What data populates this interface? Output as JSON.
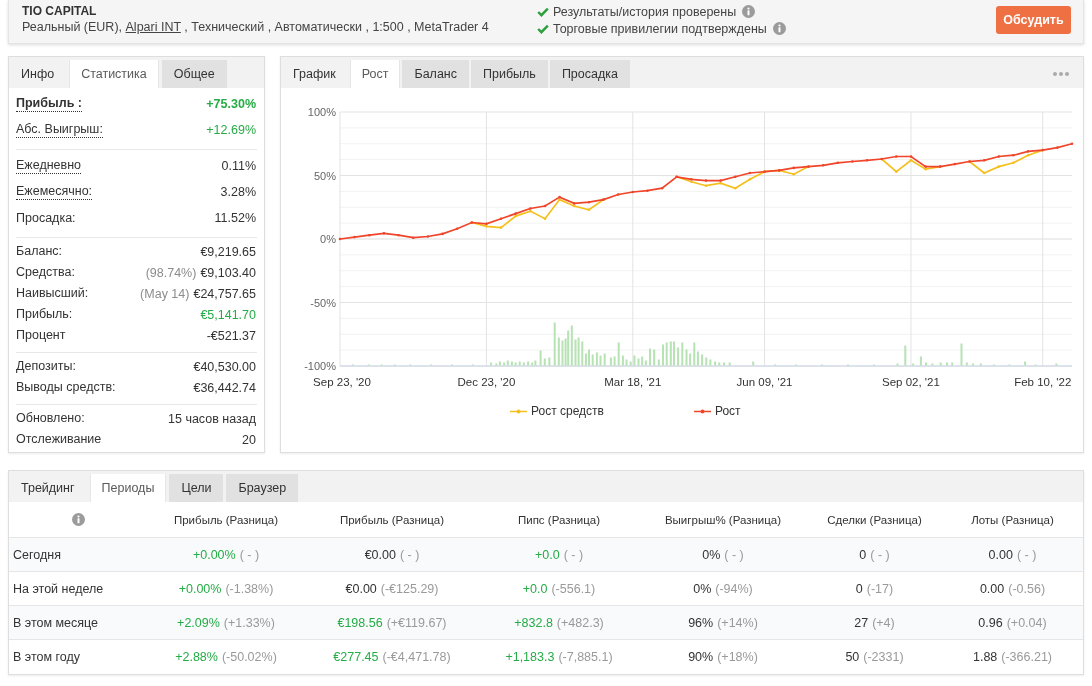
{
  "header": {
    "title": "TIO CAPITAL",
    "account": {
      "type": "Реальный (EUR),",
      "broker": "Alpari INT",
      "rest": ", Технический , Автоматически , 1:500 , MetaTrader 4"
    },
    "verifications": [
      {
        "text": "Результаты/история проверены",
        "verified": true
      },
      {
        "text": "Торговые привилегии подтверждены",
        "verified": true
      }
    ],
    "button": "Обсудить"
  },
  "stats_panel": {
    "tabs": [
      {
        "label": "Инфо",
        "selected": false
      },
      {
        "label": "Статистика",
        "selected": true
      },
      {
        "label": "Общее",
        "selected": false
      }
    ],
    "groups": [
      {
        "rows": [
          {
            "label": "Прибыль :",
            "value": "+75.30%",
            "hint": true,
            "emphasis": true,
            "positive": true
          },
          {
            "label": "Абс. Выигрыш:",
            "value": "+12.69%",
            "hint": true,
            "emphasis": false,
            "positive": true
          }
        ]
      },
      {
        "rows": [
          {
            "label": "Ежедневно",
            "value": "0.11%",
            "hint": true,
            "emphasis": false,
            "positive": false
          },
          {
            "label": "Ежемесячно:",
            "value": "3.28%",
            "hint": true,
            "emphasis": false,
            "positive": false
          },
          {
            "label": "Просадка:",
            "value": "11.52%",
            "hint": false,
            "emphasis": false,
            "positive": false
          }
        ]
      },
      {
        "rows": [
          {
            "label": "Баланс:",
            "value": "€9,219.65",
            "hint": false,
            "emphasis": false,
            "positive": false
          },
          {
            "label": "Средства:",
            "note": "(98.74%)",
            "value": "€9,103.40",
            "hint": false,
            "emphasis": false,
            "positive": false
          },
          {
            "label": "Наивысший:",
            "note": "(May 14)",
            "value": "€24,757.65",
            "hint": false,
            "emphasis": false,
            "positive": false
          },
          {
            "label": "Прибыль:",
            "value": "€5,141.70",
            "hint": false,
            "emphasis": false,
            "positive": true
          },
          {
            "label": "Процент",
            "value": "-€521.37",
            "hint": false,
            "emphasis": false,
            "positive": false
          }
        ]
      },
      {
        "rows": [
          {
            "label": "Депозиты:",
            "value": "€40,530.00",
            "hint": false,
            "emphasis": false,
            "positive": false
          },
          {
            "label": "Выводы средств:",
            "value": "€36,442.74",
            "hint": false,
            "emphasis": false,
            "positive": false
          }
        ]
      },
      {
        "rows": [
          {
            "label": "Обновлено:",
            "value": "15 часов назад",
            "hint": false,
            "emphasis": false,
            "positive": false
          },
          {
            "label": "Отслеживание",
            "value": "20",
            "hint": false,
            "emphasis": false,
            "positive": false
          }
        ]
      }
    ]
  },
  "chart_panel": {
    "tabs": [
      {
        "label": "График",
        "selected": false
      },
      {
        "label": "Рост",
        "selected": true
      },
      {
        "label": "Баланс",
        "selected": false
      },
      {
        "label": "Прибыль",
        "selected": false
      },
      {
        "label": "Просадка",
        "selected": false
      }
    ],
    "chart_data": {
      "type": "line",
      "categories": [
        "Sep 23, '20",
        null,
        null,
        null,
        null,
        null,
        null,
        null,
        null,
        null,
        "Dec 23, '20",
        null,
        null,
        null,
        null,
        null,
        null,
        null,
        null,
        null,
        "Mar 18, '21",
        null,
        null,
        null,
        null,
        null,
        null,
        null,
        null,
        "Jun 09, '21",
        null,
        null,
        null,
        null,
        null,
        null,
        null,
        null,
        null,
        "Sep 02, '21",
        null,
        null,
        null,
        null,
        null,
        null,
        null,
        null,
        "Feb 10, '22",
        null,
        null
      ],
      "series": [
        {
          "name": "Рост средств",
          "color": "#f5c01e",
          "values": [
            null,
            null,
            null,
            null,
            null,
            null,
            null,
            null,
            null,
            13,
            10,
            9,
            18,
            22,
            16,
            31,
            26,
            23,
            31,
            null,
            null,
            null,
            null,
            49,
            45,
            42,
            44,
            40,
            47,
            53,
            54,
            51,
            57,
            null,
            null,
            null,
            null,
            63,
            53,
            62,
            55,
            57,
            null,
            61,
            52,
            57,
            60,
            66,
            70,
            null,
            null
          ]
        },
        {
          "name": "Рост",
          "color": "#f0452b",
          "values": [
            0,
            1.5,
            3,
            4.5,
            3,
            1,
            2,
            4,
            8,
            13,
            12,
            16,
            20,
            24,
            26,
            33,
            28,
            29,
            31,
            35,
            37,
            38,
            40,
            49,
            47,
            46,
            46,
            49,
            52,
            53,
            54,
            56,
            57,
            58,
            60,
            61,
            62,
            63,
            65,
            65,
            57,
            57,
            59,
            61,
            62,
            65,
            66,
            69,
            70,
            72,
            75
          ]
        }
      ],
      "ylim": [
        -100,
        100
      ],
      "yticks": [
        {
          "value": 100,
          "label": "100%"
        },
        {
          "value": 50,
          "label": "50%"
        },
        {
          "value": 0,
          "label": "0%"
        },
        {
          "value": -50,
          "label": "-50%"
        },
        {
          "value": -100,
          "label": "-100%"
        }
      ],
      "grid": true,
      "legend": "bottom"
    }
  },
  "periods_panel": {
    "tabs": [
      {
        "label": "Трейдинг",
        "selected": false
      },
      {
        "label": "Периоды",
        "selected": true
      },
      {
        "label": "Цели",
        "selected": false
      },
      {
        "label": "Браузер",
        "selected": false
      }
    ],
    "columns": [
      "Прибыль (Разница)",
      "Прибыль (Разница)",
      "Пипс (Разница)",
      "Выигрыш% (Разница)",
      "Сделки (Разница)",
      "Лоты (Разница)"
    ],
    "rows": [
      {
        "label": "Сегодня",
        "cells": [
          {
            "value": "+0.00%",
            "change": "( - )",
            "positive": true
          },
          {
            "value": "€0.00",
            "change": "( - )",
            "positive": false
          },
          {
            "value": "+0.0",
            "change": "( - )",
            "positive": true
          },
          {
            "value": "0%",
            "change": "( - )",
            "positive": false
          },
          {
            "value": "0",
            "change": "( - )",
            "positive": false
          },
          {
            "value": "0.00",
            "change": "( - )",
            "positive": false
          }
        ]
      },
      {
        "label": "На этой неделе",
        "cells": [
          {
            "value": "+0.00%",
            "change": "(-1.38%)",
            "positive": true
          },
          {
            "value": "€0.00",
            "change": "(-€125.29)",
            "positive": false
          },
          {
            "value": "+0.0",
            "change": "(-556.1)",
            "positive": true
          },
          {
            "value": "0%",
            "change": "(-94%)",
            "positive": false
          },
          {
            "value": "0",
            "change": "(-17)",
            "positive": false
          },
          {
            "value": "0.00",
            "change": "(-0.56)",
            "positive": false
          }
        ]
      },
      {
        "label": "В этом месяце",
        "cells": [
          {
            "value": "+2.09%",
            "change": "(+1.33%)",
            "positive": true
          },
          {
            "value": "€198.56",
            "change": "(+€119.67)",
            "positive": true
          },
          {
            "value": "+832.8",
            "change": "(+482.3)",
            "positive": true
          },
          {
            "value": "96%",
            "change": "(+14%)",
            "positive": false
          },
          {
            "value": "27",
            "change": "(+4)",
            "positive": false
          },
          {
            "value": "0.96",
            "change": "(+0.04)",
            "positive": false
          }
        ]
      },
      {
        "label": "В этом году",
        "cells": [
          {
            "value": "+2.88%",
            "change": "(-50.02%)",
            "positive": true
          },
          {
            "value": "€277.45",
            "change": "(-€4,471.78)",
            "positive": true
          },
          {
            "value": "+1,183.3",
            "change": "(-7,885.1)",
            "positive": true
          },
          {
            "value": "90%",
            "change": "(+18%)",
            "positive": false
          },
          {
            "value": "50",
            "change": "(-2331)",
            "positive": false
          },
          {
            "value": "1.88",
            "change": "(-366.21)",
            "positive": false
          }
        ]
      }
    ]
  }
}
